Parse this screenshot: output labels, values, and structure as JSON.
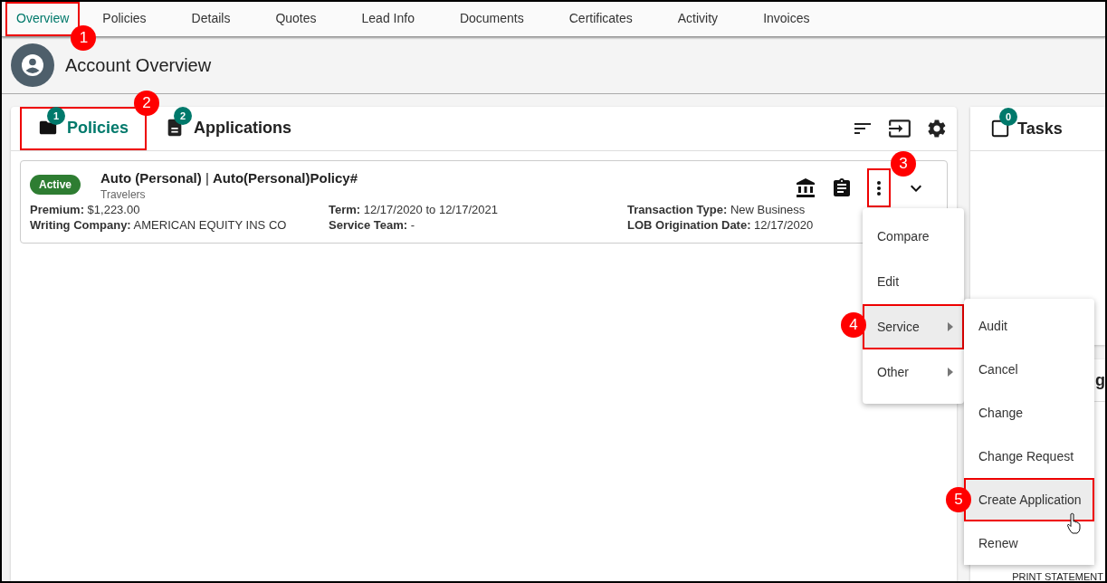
{
  "nav_tabs": [
    {
      "label": "Overview",
      "selected": true,
      "callout": "1"
    },
    {
      "label": "Policies",
      "selected": false
    },
    {
      "label": "Details",
      "selected": false
    },
    {
      "label": "Quotes",
      "selected": false
    },
    {
      "label": "Lead Info",
      "selected": false
    },
    {
      "label": "Documents",
      "selected": false
    },
    {
      "label": "Certificates",
      "selected": false
    },
    {
      "label": "Activity",
      "selected": false
    },
    {
      "label": "Invoices",
      "selected": false
    }
  ],
  "header": {
    "title": "Account Overview"
  },
  "panel_tabs": [
    {
      "label": "Policies",
      "count": "1",
      "selected": true,
      "callout": "2"
    },
    {
      "label": "Applications",
      "count": "2",
      "selected": false
    }
  ],
  "policy": {
    "status": "Active",
    "title": "**Auto (Personal)** | **Auto(Personal)Policy#**",
    "carrier": "Travelers",
    "menu_callout": "3",
    "fields": [
      {
        "label": "Premium:",
        "value": "$1,223.00"
      },
      {
        "label": "Term:",
        "value": "12/17/2020 to 12/17/2021"
      },
      {
        "label": "Transaction Type:",
        "value": "New Business"
      },
      {
        "label": "Writing Company:",
        "value": "AMERICAN EQUITY INS CO"
      },
      {
        "label": "Service Team:",
        "value": "-"
      },
      {
        "label": "LOB Origination Date:",
        "value": "12/17/2020"
      }
    ]
  },
  "menu": {
    "items": [
      {
        "label": "Compare",
        "selected": false,
        "submenu": false
      },
      {
        "label": "Edit",
        "selected": false,
        "submenu": false
      },
      {
        "label": "Service",
        "selected": true,
        "submenu": true,
        "callout": "4"
      },
      {
        "label": "Other",
        "selected": false,
        "submenu": true
      }
    ]
  },
  "submenu": {
    "items": [
      {
        "label": "Audit",
        "selected": false
      },
      {
        "label": "Cancel",
        "selected": false
      },
      {
        "label": "Change",
        "selected": false
      },
      {
        "label": "Change Request",
        "selected": false
      },
      {
        "label": "Create Application",
        "selected": true,
        "callout": "5"
      },
      {
        "label": "Renew",
        "selected": false
      }
    ]
  },
  "tasks": {
    "title": "Tasks",
    "count": "0"
  },
  "side_card": {
    "title": "g",
    "footer": "PRINT STATEMENT"
  }
}
